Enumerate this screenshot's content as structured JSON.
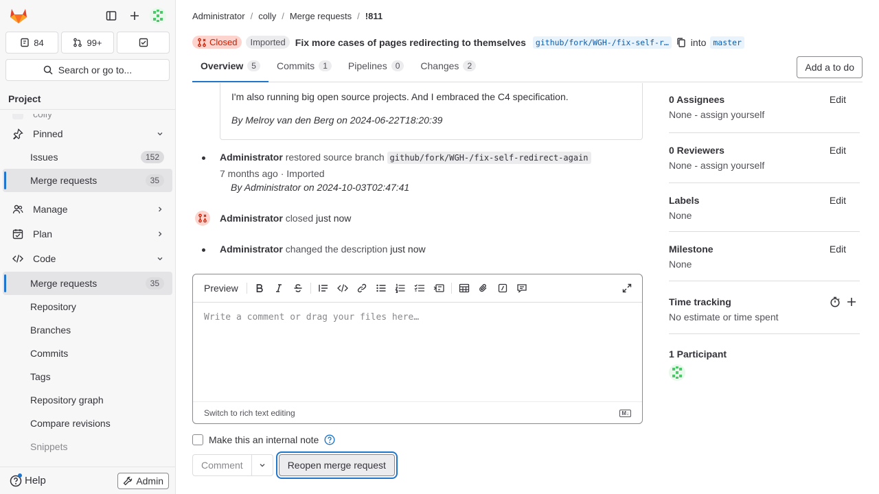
{
  "sidebar": {
    "counters": [
      "84",
      "99+",
      ""
    ],
    "search_label": "Search or go to...",
    "section_title": "Project",
    "faded_top": "colly",
    "items": [
      {
        "label": "Pinned"
      },
      {
        "label": "Issues",
        "badge": "152"
      },
      {
        "label": "Merge requests",
        "badge": "35"
      },
      {
        "label": "Manage"
      },
      {
        "label": "Plan"
      },
      {
        "label": "Code"
      },
      {
        "label": "Merge requests",
        "badge": "35"
      },
      {
        "label": "Repository"
      },
      {
        "label": "Branches"
      },
      {
        "label": "Commits"
      },
      {
        "label": "Tags"
      },
      {
        "label": "Repository graph"
      },
      {
        "label": "Compare revisions"
      },
      {
        "label": "Snippets"
      }
    ],
    "help_label": "Help",
    "admin_label": "Admin"
  },
  "breadcrumb": [
    "Administrator",
    "colly",
    "Merge requests",
    "!811"
  ],
  "mr": {
    "state": "Closed",
    "imported": "Imported",
    "title": "Fix more cases of pages redirecting to themselves",
    "source_branch": "github/fork/WGH-/fix-self-r…",
    "into": "into",
    "target_branch": "master"
  },
  "tabs": [
    {
      "label": "Overview",
      "count": "5"
    },
    {
      "label": "Commits",
      "count": "1"
    },
    {
      "label": "Pipelines",
      "count": "0"
    },
    {
      "label": "Changes",
      "count": "2"
    }
  ],
  "todo_label": "Add a to do",
  "description": {
    "text": "I'm also running big open source projects. And I embraced the C4 specification.",
    "byline": "By Melroy van den Berg on 2024-06-22T18:20:39"
  },
  "notes": {
    "n1_author": "Administrator",
    "n1_action": "restored source branch",
    "n1_branch": "github/fork/WGH-/fix-self-redirect-again",
    "n1_time": "7 months ago · Imported",
    "n1_byline": "By Administrator on 2024-10-03T02:47:41",
    "n2_author": "Administrator",
    "n2_action": "closed",
    "n2_time": "just now",
    "n3_author": "Administrator",
    "n3_action": "changed the description",
    "n3_time": "just now"
  },
  "editor": {
    "preview_label": "Preview",
    "placeholder": "Write a comment or drag your files here…",
    "switch_label": "Switch to rich text editing",
    "md_badge": "M↓"
  },
  "internal_note_label": "Make this an internal note",
  "comment_label": "Comment",
  "reopen_label": "Reopen merge request",
  "right_panel": {
    "assignees_title": "0 Assignees",
    "assignees_value": "None - assign yourself",
    "reviewers_title": "0 Reviewers",
    "reviewers_value": "None - assign yourself",
    "labels_title": "Labels",
    "labels_value": "None",
    "milestone_title": "Milestone",
    "milestone_value": "None",
    "time_title": "Time tracking",
    "time_value": "No estimate or time spent",
    "participants_title": "1 Participant",
    "edit_label": "Edit"
  }
}
